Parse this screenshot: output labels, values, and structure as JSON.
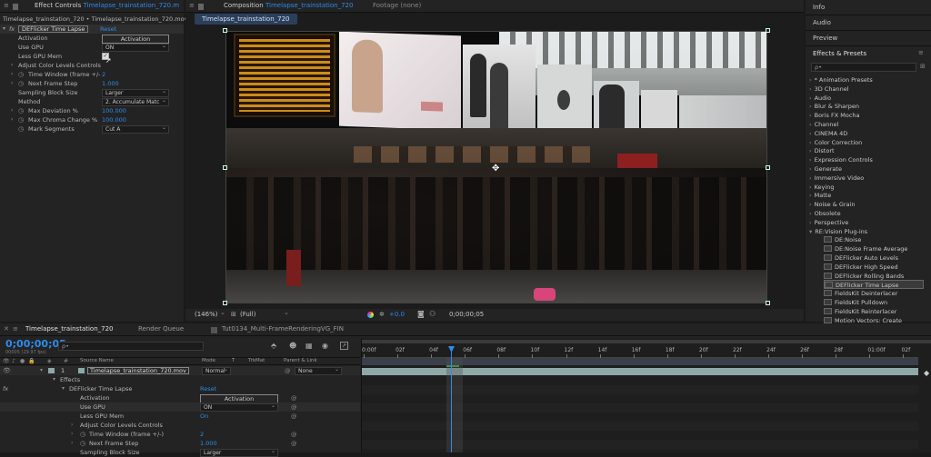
{
  "effect_controls": {
    "tab_title": "Effect Controls",
    "tab_comp": "Timelapse_trainstation_720.m",
    "breadcrumb": "Timelapse_trainstation_720 • Timelapse_trainstation_720.mov",
    "effect_name": "DEFlicker Time Lapse",
    "reset_label": "Reset",
    "activation_label": "Activation",
    "activation_button": "Activation",
    "use_gpu_label": "Use GPU",
    "use_gpu_value": "ON",
    "less_gpu_mem_label": "Less GPU Mem",
    "adjust_color_levels": "Adjust Color Levels Controls",
    "time_window_label": "Time Window (frame +/-",
    "time_window_value": "2",
    "next_frame_step_label": "Next Frame Step",
    "next_frame_step_value": "1.000",
    "sampling_block_size_label": "Sampling Block Size",
    "sampling_block_size_value": "Larger",
    "method_label": "Method",
    "method_value": "2. Accumulate Matc",
    "max_deviation_label": "Max Deviation %",
    "max_deviation_value": "100.000",
    "max_chroma_label": "Max Chroma Change %",
    "max_chroma_value": "100.000",
    "mark_segments_label": "Mark Segments",
    "mark_segments_value": "Cut A"
  },
  "composition": {
    "tab_label": "Composition",
    "tab_comp": "Timelapse_trainstation_720",
    "footage_tab": "Footage (none)",
    "subtab": "Timelapse_trainstation_720",
    "zoom": "(146%)",
    "resolution": "(Full)",
    "exposure": "+0.0",
    "timecode": "0;00;00;05"
  },
  "right_panel": {
    "info": "Info",
    "audio": "Audio",
    "preview": "Preview",
    "effects_presets": "Effects & Presets",
    "search_placeholder": "ρ•",
    "categories": [
      "* Animation Presets",
      "3D Channel",
      "Audio",
      "Blur & Sharpen",
      "Boris FX Mocha",
      "Channel",
      "CINEMA 4D",
      "Color Correction",
      "Distort",
      "Expression Controls",
      "Generate",
      "Immersive Video",
      "Keying",
      "Matte",
      "Noise & Grain",
      "Obsolete",
      "Perspective",
      "RE:Vision Plug-ins"
    ],
    "plugins": [
      "DE:Noise",
      "DE:Noise Frame Average",
      "DEFlicker Auto Levels",
      "DEFlicker High Speed",
      "DEFlicker Rolling Bands",
      "DEFlicker Time Lapse",
      "FieldsKit Deinterlacer",
      "FieldsKit Pulldown",
      "FieldsKit Reinterlacer",
      "Motion Vectors: Create"
    ]
  },
  "timeline": {
    "tab_comp": "Timelapse_trainstation_720",
    "render_queue": "Render Queue",
    "tab_other": "Tut0134_Multi-FrameRenderingVG_FIN",
    "timecode": "0;00;00;05",
    "fps": "00005 (29.97 fps)",
    "search_placeholder": "ρ•",
    "col_source": "Source Name",
    "col_mode": "Mode",
    "col_t": "T",
    "col_trkmat": "TrkMat",
    "col_parent": "Parent & Link",
    "layer_index": "1",
    "layer_name": "Timelapse_trainstation_720.mov",
    "layer_mode": "Normal",
    "layer_parent": "None",
    "effects": "Effects",
    "fx_name": "DEFlicker Time Lapse",
    "fx_reset": "Reset",
    "activation_label": "Activation",
    "activation_button": "Activation",
    "use_gpu_label": "Use GPU",
    "use_gpu_value": "ON",
    "less_gpu_label": "Less GPU Mem",
    "less_gpu_value": "On",
    "adjust_label": "Adjust Color Levels Controls",
    "time_window_label": "Time Window (frame +/-)",
    "time_window_value": "2",
    "next_frame_label": "Next Frame Step",
    "next_frame_value": "1.000",
    "sampling_label": "Sampling Block Size",
    "sampling_value": "Larger",
    "ruler": [
      "0:00f",
      "02f",
      "04f",
      "06f",
      "08f",
      "10f",
      "12f",
      "14f",
      "16f",
      "18f",
      "20f",
      "22f",
      "24f",
      "26f",
      "28f",
      "01:00f",
      "02f"
    ],
    "playhead_fraction": 0.16
  },
  "colors": {
    "accent": "#2d8ceb",
    "panel": "#232323",
    "background": "#1a1a1a",
    "layer_bar": "#8fa8a8"
  }
}
